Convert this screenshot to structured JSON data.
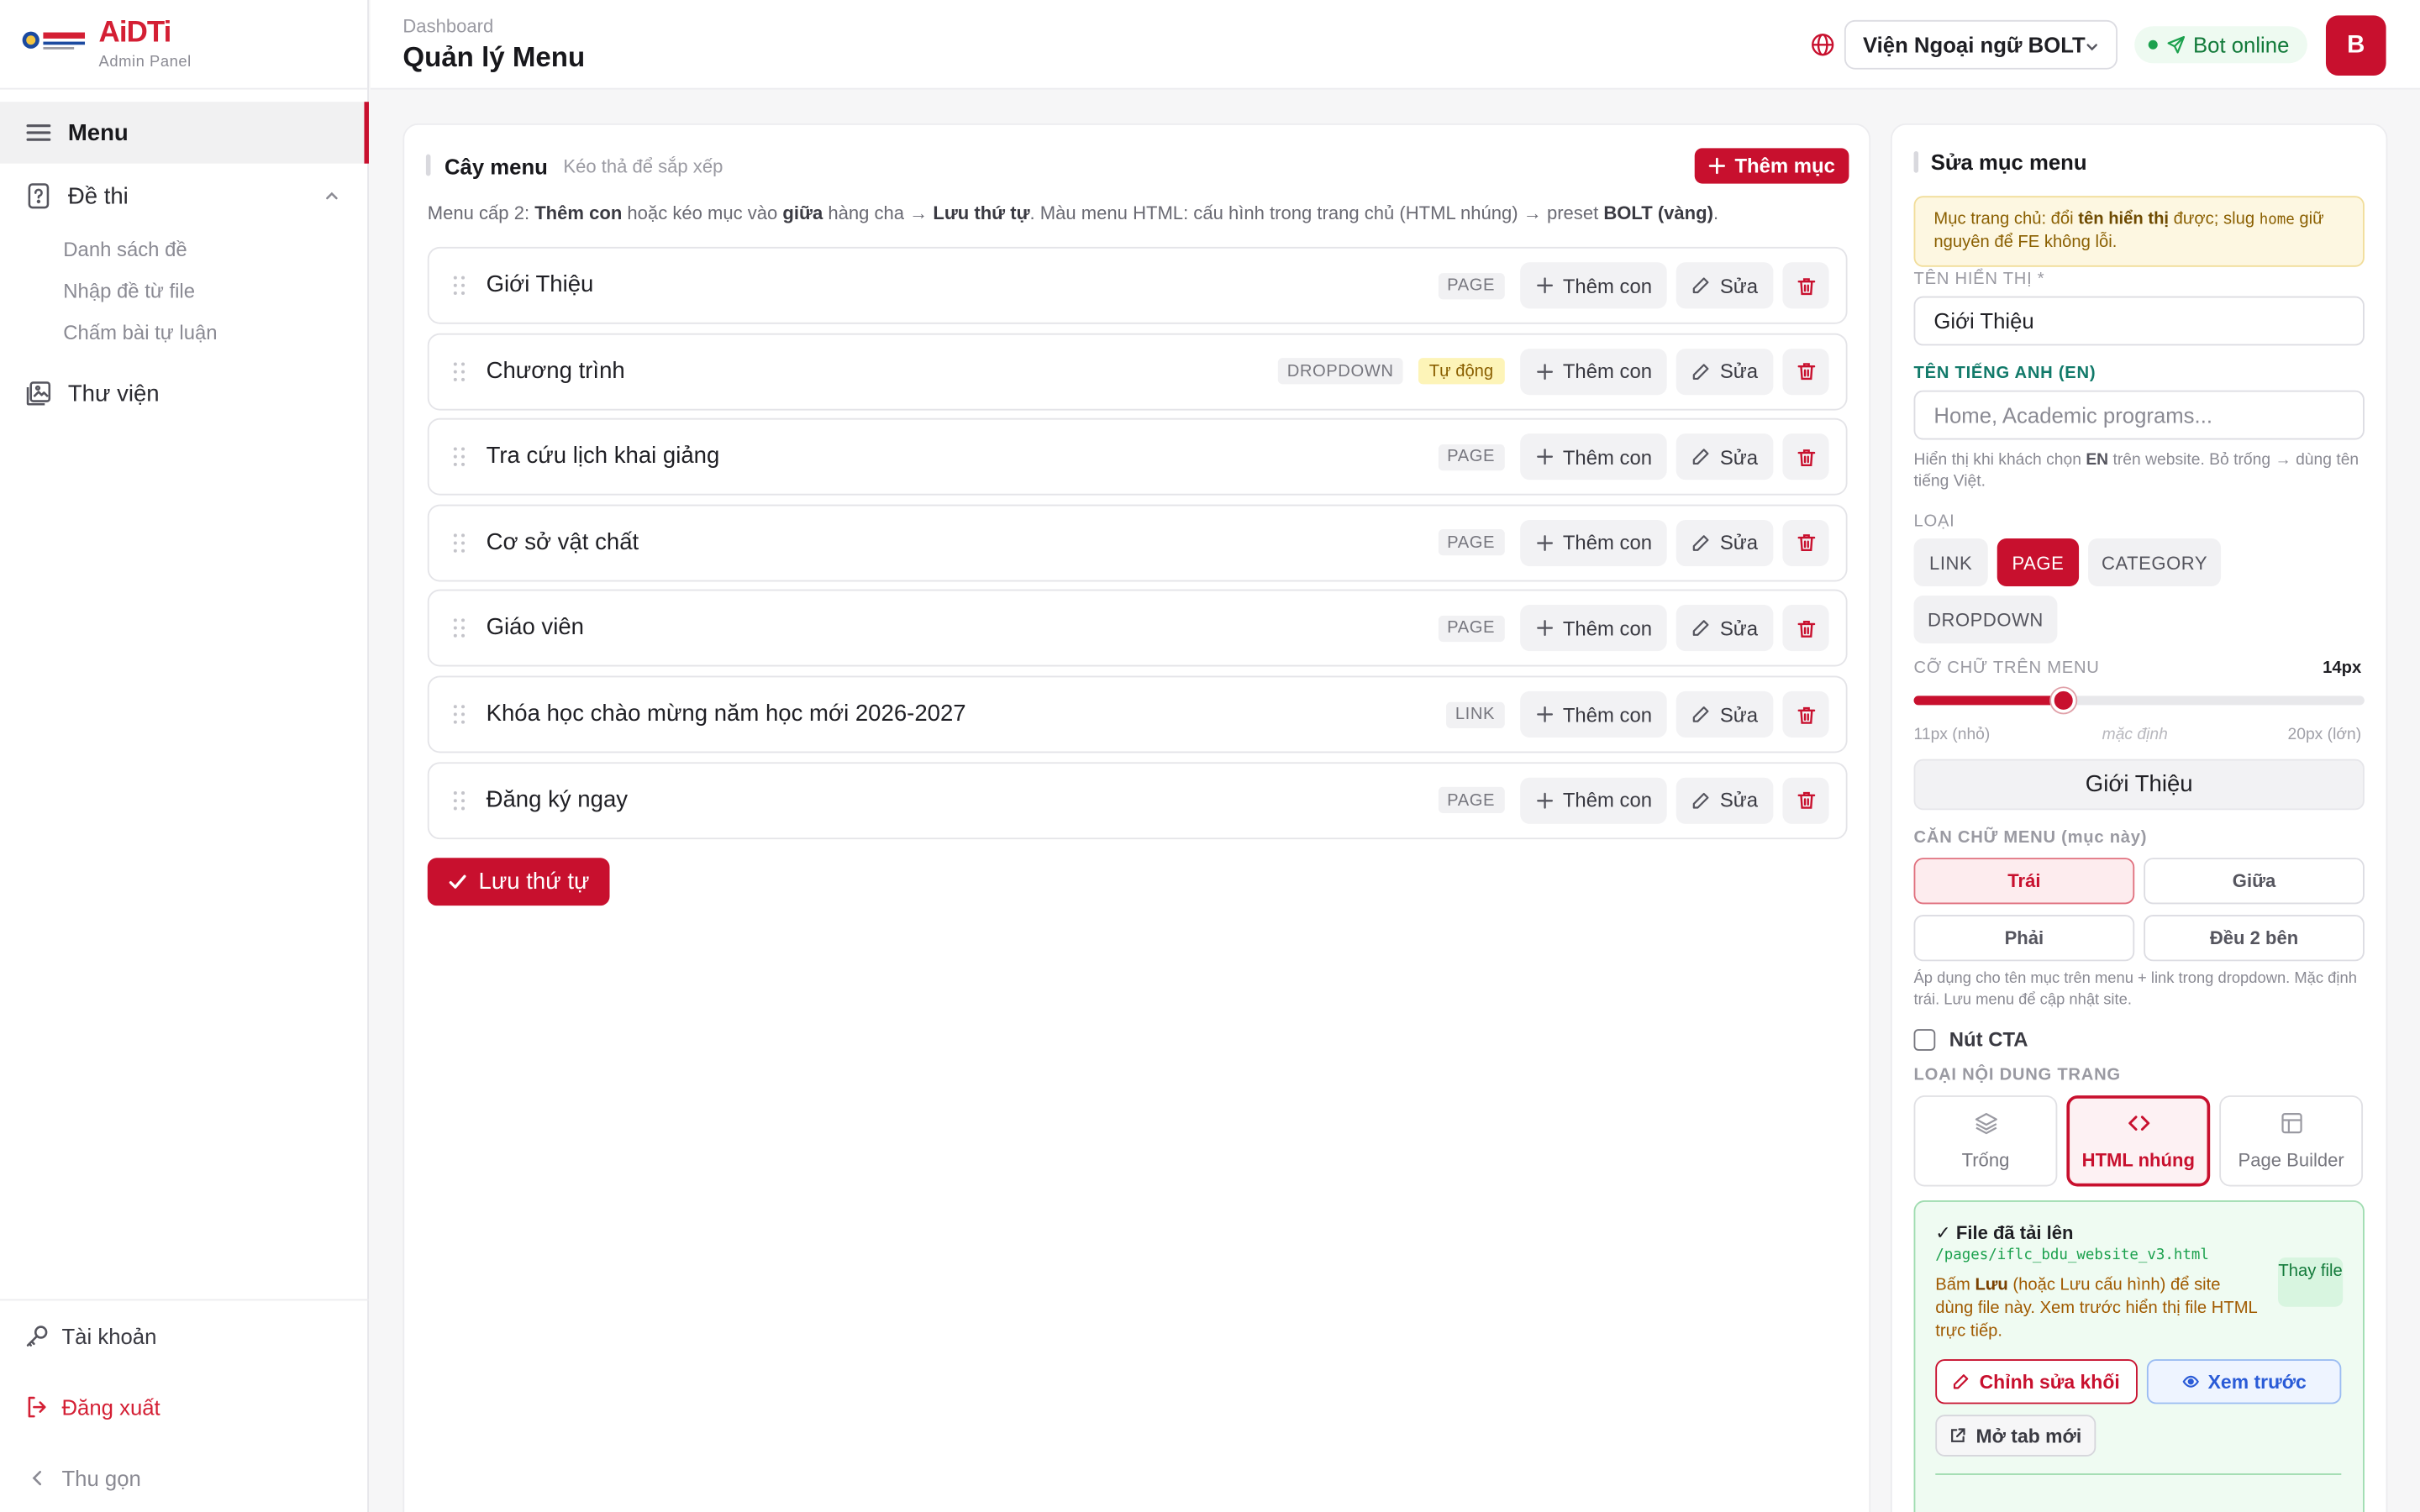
{
  "brand": {
    "name": "AiDTi",
    "subtitle": "Admin Panel"
  },
  "sidebar": {
    "items": [
      {
        "label": "Menu",
        "icon": "hamburger-icon",
        "active": true
      },
      {
        "label": "Đề thi",
        "icon": "question-file-icon",
        "expanded": true
      },
      {
        "label": "Thư viện",
        "icon": "gallery-icon"
      }
    ],
    "exam_subitems": [
      "Danh sách đề",
      "Nhập đề từ file",
      "Chấm bài tự luận"
    ],
    "bottom": {
      "account": "Tài khoản",
      "logout": "Đăng xuất",
      "collapse": "Thu gọn"
    }
  },
  "header": {
    "breadcrumb": "Dashboard",
    "title": "Quản lý Menu",
    "org_select": "Viện Ngoại ngữ BOLT",
    "bot_status": "Bot online",
    "avatar_initial": "B"
  },
  "tree": {
    "title": "Cây menu",
    "hint": "Kéo thả để sắp xếp",
    "add_label": "Thêm mục",
    "desc": {
      "p1": "Menu cấp 2: ",
      "b1": "Thêm con",
      "p2": " hoặc kéo mục vào ",
      "b2": "giữa",
      "p3": " hàng cha → ",
      "b3": "Lưu thứ tự",
      "p4": ". Màu menu HTML: cấu hình trong trang chủ (HTML nhúng) → preset ",
      "b4": "BOLT (vàng)",
      "p5": "."
    },
    "add_child_label": "Thêm con",
    "edit_label": "Sửa",
    "rows": [
      {
        "label": "Giới Thiệu",
        "type": "PAGE",
        "auto": ""
      },
      {
        "label": "Chương trình",
        "type": "DROPDOWN",
        "auto": "Tự động"
      },
      {
        "label": "Tra cứu lịch khai giảng",
        "type": "PAGE",
        "auto": ""
      },
      {
        "label": "Cơ sở vật chất",
        "type": "PAGE",
        "auto": ""
      },
      {
        "label": "Giáo viên",
        "type": "PAGE",
        "auto": ""
      },
      {
        "label": "Khóa học chào mừng năm học mới 2026-2027",
        "type": "LINK",
        "auto": ""
      },
      {
        "label": "Đăng ký ngay",
        "type": "PAGE",
        "auto": ""
      }
    ],
    "save_label": "Lưu thứ tự"
  },
  "edit": {
    "title": "Sửa mục menu",
    "warning": {
      "p1": "Mục trang chủ: đổi ",
      "b1": "tên hiển thị",
      "p2": " được; slug ",
      "code": "home",
      "p3": " giữ nguyên để FE không lỗi."
    },
    "display_name_label": "TÊN HIỂN THỊ *",
    "display_name_value": "Giới Thiệu",
    "en_label": "TÊN TIẾNG ANH (EN)",
    "en_placeholder": "Home, Academic programs...",
    "en_helper": {
      "p1": "Hiển thị khi khách chọn ",
      "b1": "EN",
      "p2": " trên website. Bỏ trống → dùng tên tiếng Việt."
    },
    "type_label": "LOẠI",
    "types": [
      "LINK",
      "PAGE",
      "CATEGORY",
      "DROPDOWN"
    ],
    "type_selected": "PAGE",
    "font_size_label": "CỠ CHỮ TRÊN MENU",
    "font_size_value": "14px",
    "font_size_fraction": 0.3333,
    "scale_min": "11px (nhỏ)",
    "scale_mid": "mặc định",
    "scale_max": "20px (lớn)",
    "preview_text": "Giới Thiệu",
    "align_label": "CĂN CHỮ MENU (mục này)",
    "align_options": [
      "Trái",
      "Giữa",
      "Phải",
      "Đều 2 bên"
    ],
    "align_selected": "Trái",
    "align_helper": "Áp dụng cho tên mục trên menu + link trong dropdown. Mặc định trái. Lưu menu để cập nhật site.",
    "cta_label": "Nút CTA",
    "content_type_label": "LOẠI NỘI DUNG TRANG",
    "content_types": [
      {
        "label": "Trống",
        "icon": "layers-icon"
      },
      {
        "label": "HTML nhúng",
        "icon": "code-icon"
      },
      {
        "label": "Page Builder",
        "icon": "layout-icon"
      }
    ],
    "content_type_selected": "HTML nhúng",
    "file": {
      "title": "✓ File đã tải lên",
      "path": "/pages/iflc_bdu_website_v3.html",
      "desc_p1": "Bấm ",
      "desc_b1": "Lưu",
      "desc_p2": " (hoặc Lưu cấu hình) để site dùng file này. Xem trước hiển thị file HTML trực tiếp.",
      "replace_label": "Thay file",
      "edit_blocks_label": "Chỉnh sửa khối",
      "preview_label": "Xem trước",
      "new_tab_label": "Mở tab mới"
    }
  },
  "colors": {
    "accent": "#c8102e",
    "success": "#1ca14e",
    "warning_bg": "#fdf7e1",
    "info": "#2a5bd7"
  }
}
